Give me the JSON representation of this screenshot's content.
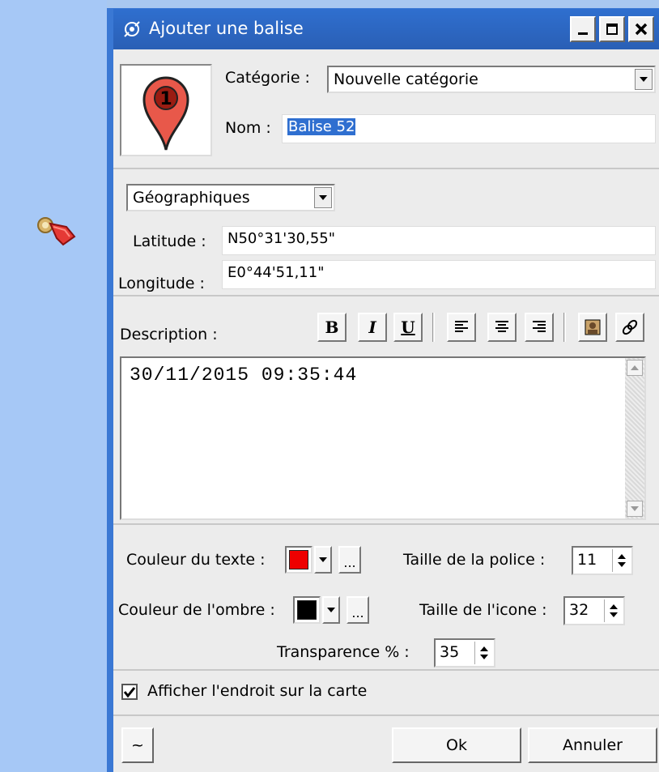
{
  "window": {
    "title": "Ajouter une balise"
  },
  "top": {
    "category_label": "Catégorie :",
    "category_value": "Nouvelle catégorie",
    "name_label": "Nom :",
    "name_value": "Balise 52",
    "marker_number": "1"
  },
  "coords": {
    "format_value": "Géographiques",
    "latitude_label": "Latitude :",
    "latitude_value": "N50°31'30,55\"",
    "longitude_label": "Longitude :",
    "longitude_value": "E0°44'51,11\""
  },
  "description": {
    "label": "Description :",
    "text": "30/11/2015 09:35:44",
    "toolbar": {
      "bold": "B",
      "italic": "I",
      "underline": "U"
    }
  },
  "options": {
    "text_color_label": "Couleur du texte :",
    "text_color": "#ee0000",
    "shadow_color_label": "Couleur de l'ombre :",
    "shadow_color": "#000000",
    "dots_label": "...",
    "font_size_label": "Taille de la police :",
    "font_size_value": "11",
    "icon_size_label": "Taille de l'icone :",
    "icon_size_value": "32",
    "transparency_label": "Transparence % :",
    "transparency_value": "35"
  },
  "show": {
    "checked": true,
    "label": "Afficher l'endroit sur la carte"
  },
  "footer": {
    "tilde_label": "~",
    "ok_label": "Ok",
    "cancel_label": "Annuler"
  },
  "icons": {
    "map_marker": "map-marker-icon",
    "marker_pin": "red-pin-icon",
    "title": "satellite-icon",
    "align": [
      "align-left-icon",
      "align-center-icon",
      "align-right-icon"
    ],
    "insert": [
      "insert-image-icon",
      "insert-link-icon"
    ]
  }
}
